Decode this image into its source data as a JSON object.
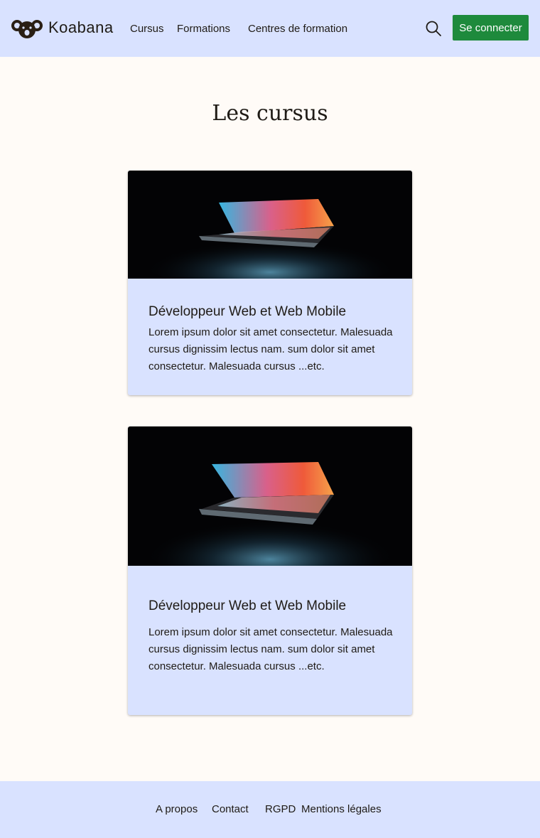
{
  "header": {
    "brand": "Koabana",
    "nav": [
      "Cursus",
      "Formations",
      "Centres de formation"
    ],
    "login_label": "Se connecter",
    "search_icon": "search-icon",
    "logo_icon": "koala-icon",
    "accent_color": "#1e8a3c",
    "header_bg": "#d9e2ff"
  },
  "main": {
    "title": "Les cursus",
    "cards": [
      {
        "title": "Développeur Web et Web Mobile",
        "text": "Lorem ipsum dolor sit amet consectetur. Malesuada cursus dignissim lectus nam. sum dolor sit amet consectetur. Malesuada cursus ...etc."
      },
      {
        "title": "Développeur Web et Web Mobile",
        "text": "Lorem ipsum dolor sit amet consectetur. Malesuada cursus dignissim lectus nam. sum dolor sit amet consectetur. Malesuada cursus ...etc."
      }
    ]
  },
  "footer": {
    "links": [
      "A propos",
      "Contact",
      "RGPD",
      "Mentions légales"
    ]
  }
}
